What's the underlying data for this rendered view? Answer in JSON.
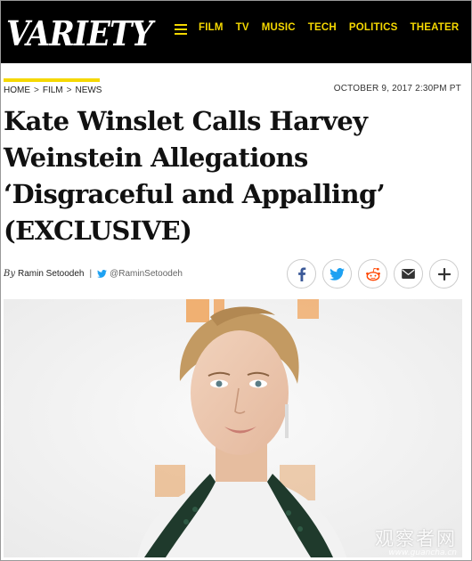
{
  "header": {
    "brand": "VARIETY",
    "nav": [
      "FILM",
      "TV",
      "MUSIC",
      "TECH",
      "POLITICS",
      "THEATER"
    ]
  },
  "breadcrumb": [
    "HOME",
    "FILM",
    "NEWS"
  ],
  "breadcrumb_sep": ">",
  "date": "OCTOBER 9, 2017 2:30PM PT",
  "title": "Kate Winslet Calls Harvey Weinstein Allegations ‘Disgraceful and Appalling’ (EXCLUSIVE)",
  "byline": {
    "by": "By",
    "author": "Ramin Setoodeh",
    "pipe": "|",
    "twitter_handle": "@RaminSetoodeh"
  },
  "share_icons": [
    "facebook-icon",
    "twitter-icon",
    "reddit-icon",
    "email-icon",
    "plus-icon"
  ],
  "watermark": {
    "line1": "观察者网",
    "line2": "www.guancha.cn"
  },
  "colors": {
    "brand_yellow": "#f5d800",
    "header_bg": "#000000",
    "facebook": "#3b5998",
    "twitter": "#1da1f2",
    "reddit": "#ff4500"
  }
}
